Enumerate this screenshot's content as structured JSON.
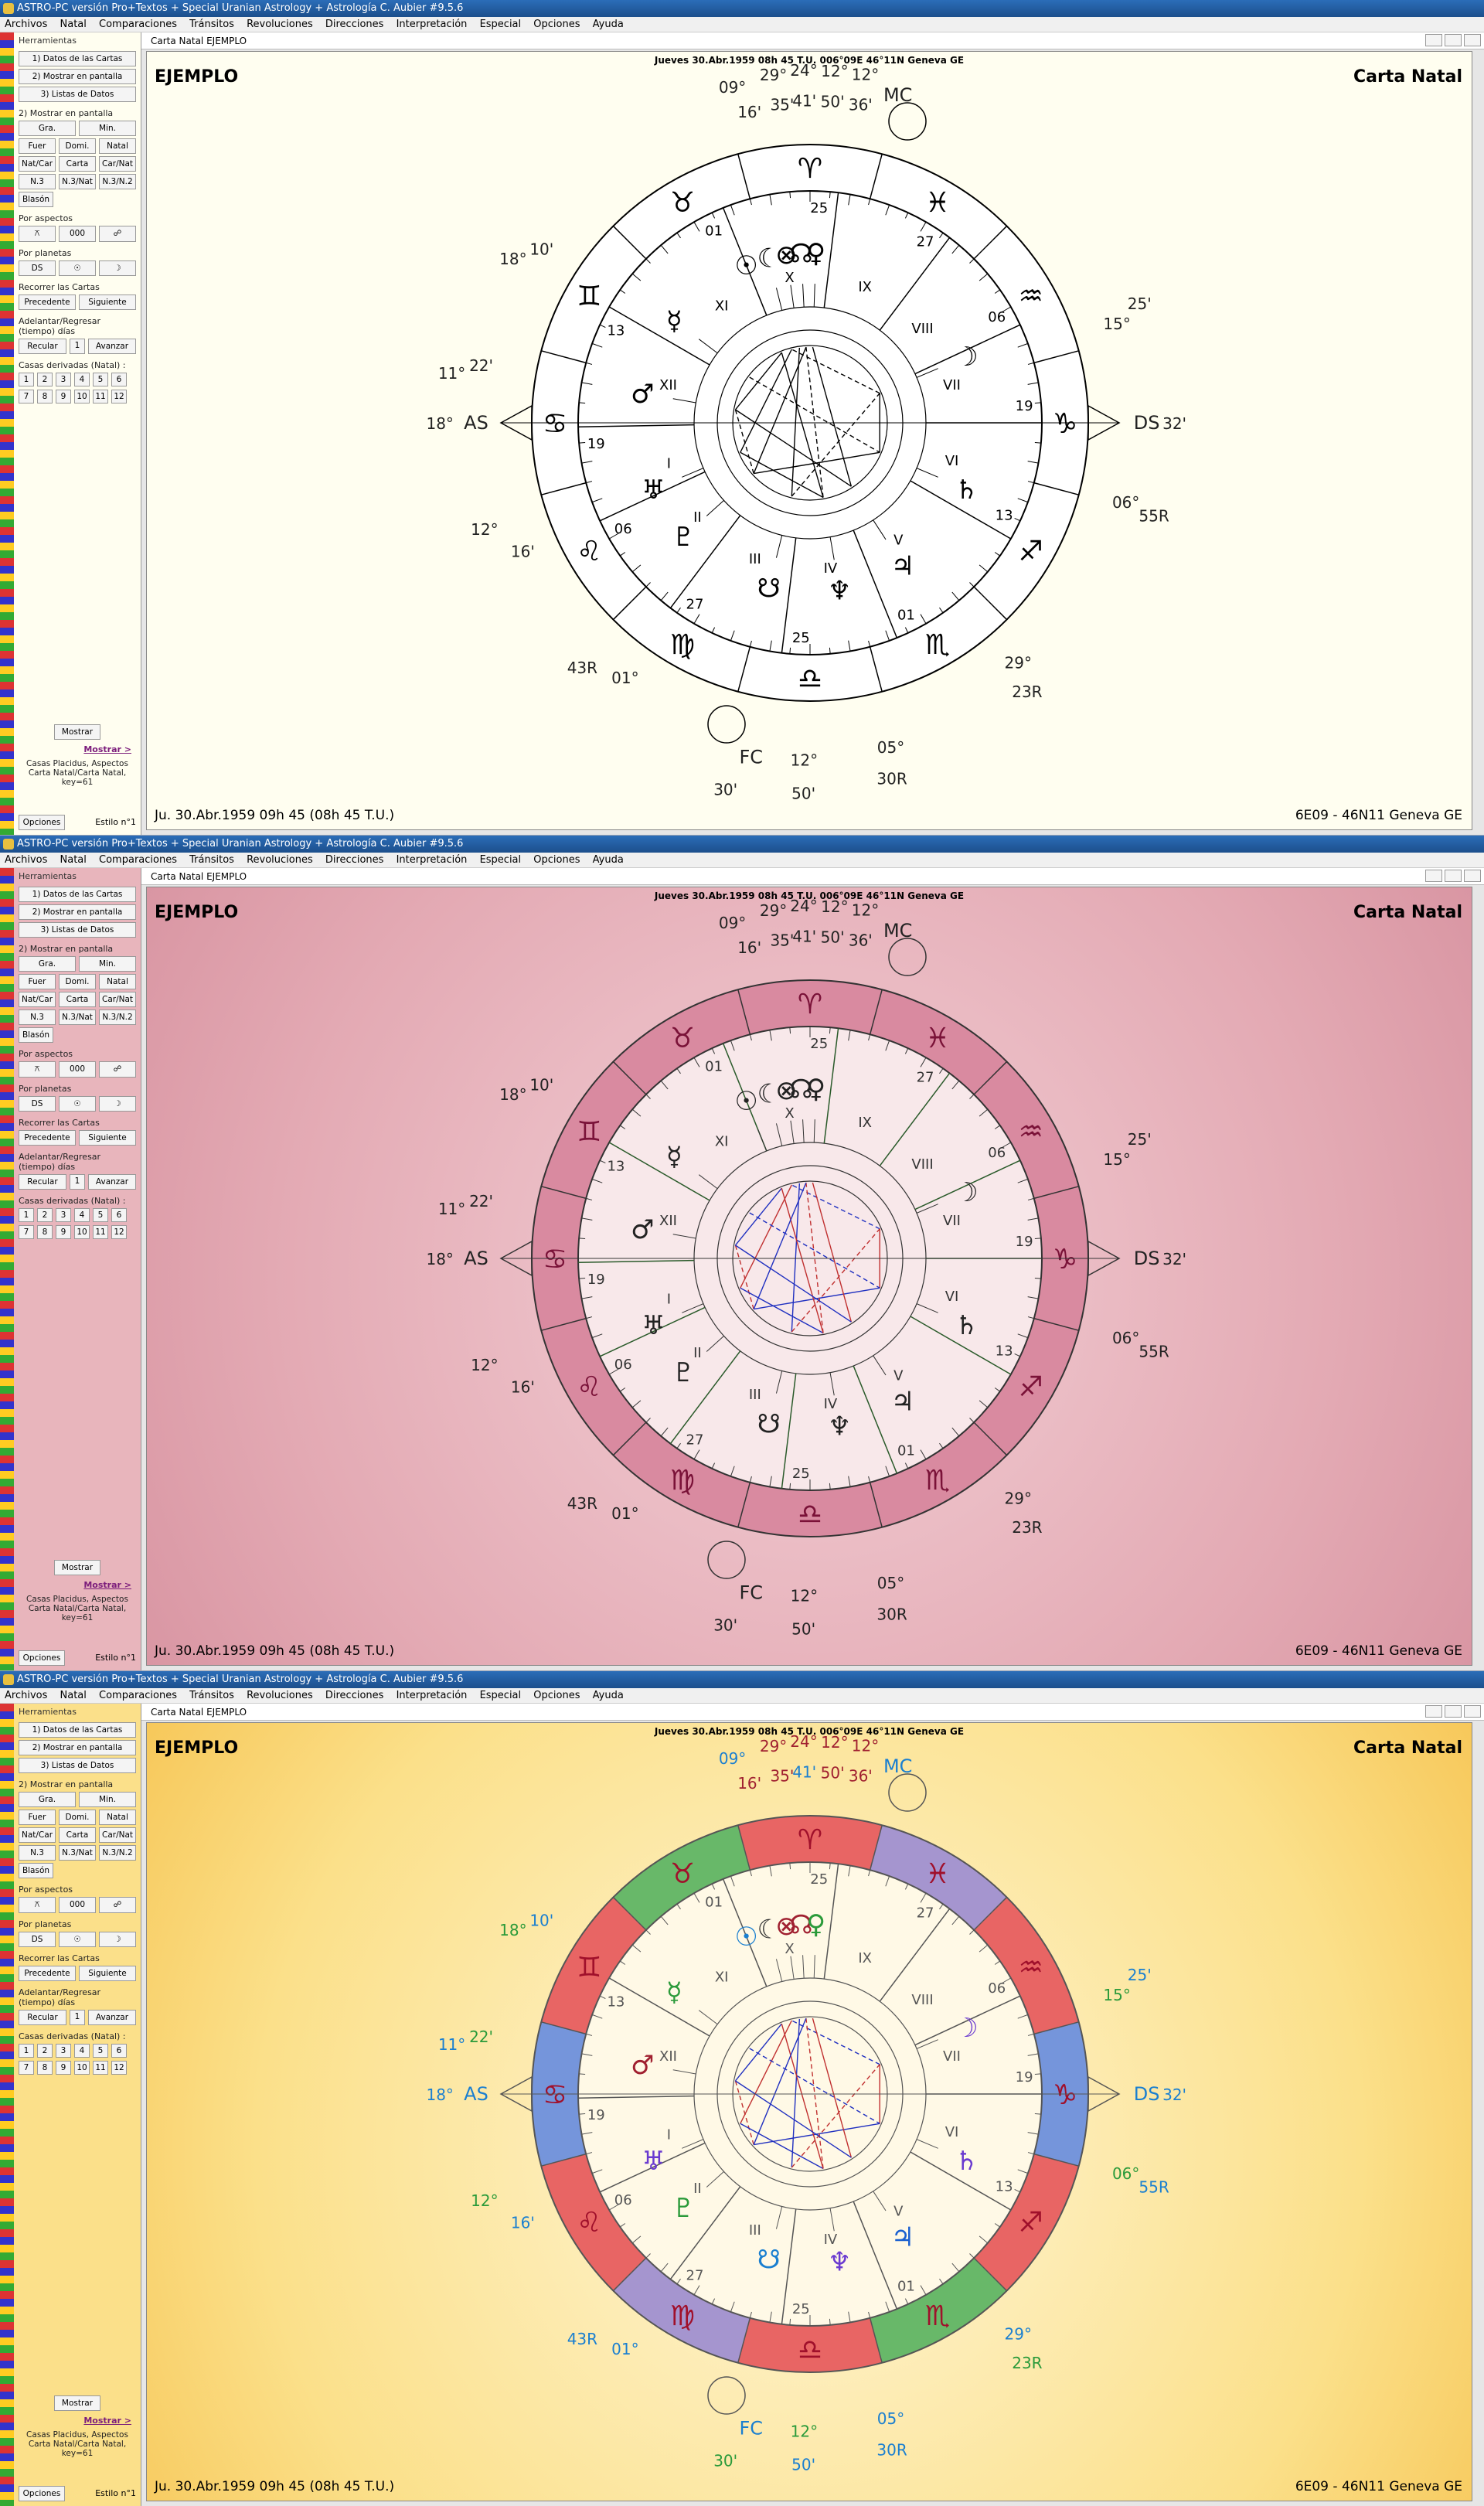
{
  "app_title": "ASTRO-PC versión Pro+Textos + Special Uranian Astrology + Astrología C. Aubier #9.5.6",
  "menu": [
    "Archivos",
    "Natal",
    "Comparaciones",
    "Tránsitos",
    "Revoluciones",
    "Direcciones",
    "Interpretación",
    "Especial",
    "Opciones",
    "Ayuda"
  ],
  "panel": {
    "heading": "Herramientas",
    "buttons": [
      "1) Datos de las Cartas",
      "2) Mostrar en pantalla",
      "3) Listas de Datos"
    ],
    "mostrar_title": "2) Mostrar en pantalla",
    "grid": [
      [
        "Gra.",
        "Min."
      ],
      [
        "Fuer",
        "Domi.",
        "Natal"
      ],
      [
        "Nat/Car",
        "Carta",
        "Car/Nat"
      ],
      [
        "N.3",
        "N.3/Nat",
        "N.3/N.2"
      ]
    ],
    "blazon": "Blasón",
    "aspects_label": "Por aspectos",
    "aspects_value": "000",
    "planets_label": "Por planetas",
    "planets_value": "DS",
    "recorrer_label": "Recorrer las Cartas",
    "precedente": "Precedente",
    "siguiente": "Siguiente",
    "adelantar_label": "Adelantar/Regresar (tiempo) días",
    "recular": "Recular",
    "dias_value": "1",
    "avanzar": "Avanzar",
    "casas_label": "Casas derivadas (Natal) :",
    "casas": [
      "1",
      "2",
      "3",
      "4",
      "5",
      "6",
      "7",
      "8",
      "9",
      "10",
      "11",
      "12"
    ],
    "mostrar_btn": "Mostrar",
    "mostrar_link": "Mostrar >",
    "note": "Casas Placidus, Aspectos Carta Natal/Carta Natal, key=61",
    "opciones": "Opciones",
    "estilo": "Estilo n°1"
  },
  "inner_title": "Carta Natal  EJEMPLO",
  "chart": {
    "topline": "Jueves 30.Abr.1959 08h 45 T.U. 006°09E 46°11N  Geneva GE",
    "name": "EJEMPLO",
    "type": "Carta Natal",
    "date": "Ju. 30.Abr.1959 09h 45 (08h 45 T.U.)",
    "place": "6E09 - 46N11  Geneva GE",
    "labels": [
      {
        "t": "09°",
        "a": 103,
        "r": 1.24
      },
      {
        "t": "16'",
        "a": 101,
        "r": 1.14
      },
      {
        "t": "29°",
        "a": 96,
        "r": 1.26
      },
      {
        "t": "35'",
        "a": 95,
        "r": 1.15
      },
      {
        "t": "24°",
        "a": 91,
        "r": 1.27
      },
      {
        "t": "41'",
        "a": 91,
        "r": 1.16
      },
      {
        "t": "12°",
        "a": 86,
        "r": 1.27
      },
      {
        "t": "50'",
        "a": 86,
        "r": 1.16
      },
      {
        "t": "12°",
        "a": 81,
        "r": 1.27
      },
      {
        "t": "36'",
        "a": 81,
        "r": 1.16
      },
      {
        "t": "MC",
        "a": 75,
        "r": 1.22
      },
      {
        "t": "25'",
        "a": 20,
        "r": 1.26
      },
      {
        "t": "15°",
        "a": 18,
        "r": 1.16
      },
      {
        "t": "DS",
        "a": 0,
        "r": 1.21
      },
      {
        "t": "32'",
        "a": 0,
        "r": 1.31
      },
      {
        "t": "06°",
        "a": -14,
        "r": 1.17
      },
      {
        "t": "55R",
        "a": -15,
        "r": 1.28
      },
      {
        "t": "29°",
        "a": -49,
        "r": 1.14
      },
      {
        "t": "23R",
        "a": -51,
        "r": 1.24
      },
      {
        "t": "05°",
        "a": -76,
        "r": 1.2
      },
      {
        "t": "30R",
        "a": -77,
        "r": 1.31
      },
      {
        "t": "12°",
        "a": -91,
        "r": 1.21
      },
      {
        "t": "50'",
        "a": -91,
        "r": 1.33
      },
      {
        "t": "FC",
        "a": -100,
        "r": 1.22
      },
      {
        "t": "30'",
        "a": -103,
        "r": 1.35
      },
      {
        "t": "01°",
        "a": -126,
        "r": 1.13
      },
      {
        "t": "43R",
        "a": -133,
        "r": 1.2
      },
      {
        "t": "12°",
        "a": -162,
        "r": 1.23
      },
      {
        "t": "16'",
        "a": -156,
        "r": 1.13
      },
      {
        "t": "11°",
        "a": 172,
        "r": 1.3
      },
      {
        "t": "22'",
        "a": 170,
        "r": 1.2
      },
      {
        "t": "AS",
        "a": 180,
        "r": 1.2
      },
      {
        "t": "18°",
        "a": 180,
        "r": 1.33
      },
      {
        "t": "18°",
        "a": 151,
        "r": 1.22
      },
      {
        "t": "10'",
        "a": 147,
        "r": 1.15
      }
    ],
    "houses": [
      "I",
      "II",
      "III",
      "IV",
      "V",
      "VI",
      "VII",
      "VIII",
      "IX",
      "X",
      "XI",
      "XII"
    ],
    "signs": [
      "♈",
      "♉",
      "♊",
      "♋",
      "♌",
      "♍",
      "♎",
      "♏",
      "♐",
      "♑",
      "♒",
      "♓"
    ],
    "planets": [
      {
        "g": "☉",
        "a": 112
      },
      {
        "g": "☾",
        "a": 104
      },
      {
        "g": "⊗",
        "a": 98
      },
      {
        "g": "☊",
        "a": 93
      },
      {
        "g": "♀",
        "a": 88
      },
      {
        "g": "☿",
        "a": 143
      },
      {
        "g": "♂",
        "a": 170
      },
      {
        "g": "♅",
        "a": 203
      },
      {
        "g": "♇",
        "a": 222
      },
      {
        "g": "☋",
        "a": 256
      },
      {
        "g": "♆",
        "a": 280
      },
      {
        "g": "♃",
        "a": 303
      },
      {
        "g": "♄",
        "a": 337
      },
      {
        "g": "☽",
        "a": 23
      }
    ],
    "cusps": [
      {
        "t": "19",
        "a": 181
      },
      {
        "t": "06",
        "a": 205
      },
      {
        "t": "27",
        "a": 233
      },
      {
        "t": "25",
        "a": 263
      },
      {
        "t": "01",
        "a": 292
      },
      {
        "t": "13",
        "a": 330
      },
      {
        "t": "19",
        "a": 0
      },
      {
        "t": "06",
        "a": 25
      },
      {
        "t": "27",
        "a": 53
      },
      {
        "t": "25",
        "a": 83
      },
      {
        "t": "01",
        "a": 112
      },
      {
        "t": "13",
        "a": 150
      }
    ]
  },
  "styles": [
    {
      "bg": "#fffef0",
      "ring": "#ffffff",
      "stroke": "#000000",
      "accent": "#000000"
    },
    {
      "bg": "#e8b5bc",
      "ring": "#d98aa0",
      "stroke": "#333333",
      "accent": "#7a1238"
    },
    {
      "bg": "#fbe08a",
      "ring": "#f5e7b3",
      "stroke": "#555555",
      "accent": "#a0102b"
    }
  ]
}
